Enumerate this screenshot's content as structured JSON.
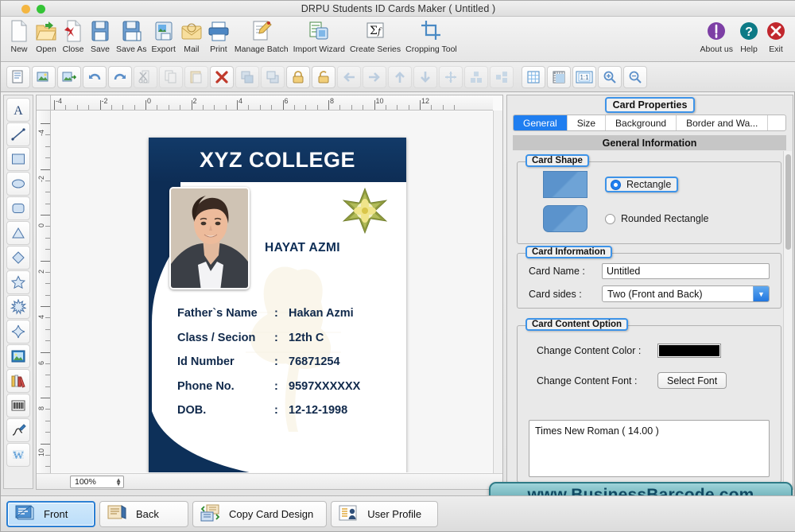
{
  "window": {
    "title": "DRPU Students ID Cards Maker ( Untitled )",
    "dots": [
      "minimize-dot",
      "maximize-dot"
    ]
  },
  "toolbar": {
    "items": [
      {
        "label": "New",
        "icon": "new-document-icon"
      },
      {
        "label": "Open",
        "icon": "open-folder-icon"
      },
      {
        "label": "Close",
        "icon": "close-document-icon"
      },
      {
        "label": "Save",
        "icon": "save-floppy-icon"
      },
      {
        "label": "Save As",
        "icon": "save-as-floppy-icon"
      },
      {
        "label": "Export",
        "icon": "export-image-icon"
      },
      {
        "label": "Mail",
        "icon": "mail-envelope-icon"
      },
      {
        "label": "Print",
        "icon": "printer-icon"
      },
      {
        "label": "Manage Batch",
        "icon": "manage-batch-icon"
      },
      {
        "label": "Import Wizard",
        "icon": "import-wizard-icon"
      },
      {
        "label": "Create Series",
        "icon": "create-series-sigma-icon"
      },
      {
        "label": "Cropping Tool",
        "icon": "cropping-tool-icon"
      }
    ],
    "right_items": [
      {
        "label": "About us",
        "icon": "about-info-icon",
        "color": "#7d3fa5"
      },
      {
        "label": "Help",
        "icon": "help-question-icon",
        "color": "#0d7a86"
      },
      {
        "label": "Exit",
        "icon": "exit-x-icon",
        "color": "#c1272d"
      }
    ]
  },
  "toolbar2": {
    "buttons": [
      {
        "name": "edit-properties-icon",
        "enabled": true
      },
      {
        "name": "insert-image-icon",
        "enabled": true
      },
      {
        "name": "export-image-icon",
        "enabled": true
      },
      {
        "name": "undo-icon",
        "enabled": true
      },
      {
        "name": "redo-icon",
        "enabled": true
      },
      {
        "name": "cut-icon",
        "enabled": false
      },
      {
        "name": "copy-icon",
        "enabled": false
      },
      {
        "name": "paste-icon",
        "enabled": false
      },
      {
        "name": "delete-icon",
        "enabled": true
      },
      {
        "name": "bring-to-front-icon",
        "enabled": false
      },
      {
        "name": "send-to-back-icon",
        "enabled": false
      },
      {
        "name": "lock-icon",
        "enabled": true
      },
      {
        "name": "unlock-icon",
        "enabled": true
      },
      {
        "name": "align-left-icon",
        "enabled": false
      },
      {
        "name": "align-right-icon",
        "enabled": false
      },
      {
        "name": "align-top-icon",
        "enabled": false
      },
      {
        "name": "align-bottom-icon",
        "enabled": false
      },
      {
        "name": "center-icon",
        "enabled": false
      },
      {
        "name": "distribute-horizontal-icon",
        "enabled": false
      },
      {
        "name": "distribute-vertical-icon",
        "enabled": false
      },
      {
        "name": "show-grid-icon",
        "enabled": true
      },
      {
        "name": "show-ruler-icon",
        "enabled": true
      },
      {
        "name": "actual-size-icon",
        "enabled": true,
        "label": "1:1"
      },
      {
        "name": "zoom-in-icon",
        "enabled": true
      },
      {
        "name": "zoom-out-icon",
        "enabled": true
      }
    ]
  },
  "palette": {
    "tools": [
      {
        "name": "text-tool",
        "glyph": "A"
      },
      {
        "name": "line-tool",
        "glyph": "line"
      },
      {
        "name": "rectangle-tool",
        "glyph": "rect"
      },
      {
        "name": "ellipse-tool",
        "glyph": "ellipse"
      },
      {
        "name": "rounded-rectangle-tool",
        "glyph": "roundrect"
      },
      {
        "name": "triangle-tool",
        "glyph": "triangle"
      },
      {
        "name": "diamond-tool",
        "glyph": "diamond"
      },
      {
        "name": "star-tool",
        "glyph": "star5"
      },
      {
        "name": "starburst-tool",
        "glyph": "starburst"
      },
      {
        "name": "four-point-star-tool",
        "glyph": "star4"
      },
      {
        "name": "image-tool",
        "glyph": "image"
      },
      {
        "name": "library-tool",
        "glyph": "books"
      },
      {
        "name": "barcode-tool",
        "glyph": "barcode"
      },
      {
        "name": "signature-tool",
        "glyph": "pen"
      },
      {
        "name": "watermark-tool",
        "glyph": "W"
      }
    ]
  },
  "canvas": {
    "ruler_h_labels": [
      "-4",
      "-2",
      "0",
      "2",
      "4",
      "6",
      "8",
      "10",
      "12"
    ],
    "ruler_v_labels": [
      "-4",
      "-2",
      "0",
      "2",
      "4",
      "6",
      "8",
      "10"
    ],
    "zoom": "100%"
  },
  "card": {
    "college_name": "XYZ COLLEGE",
    "person_name": "HAYAT AZMI",
    "fields": [
      {
        "key": "Father`s Name",
        "colon": ":",
        "value": "Hakan Azmi"
      },
      {
        "key": "Class / Secion",
        "colon": ":",
        "value": "12th C"
      },
      {
        "key": "Id Number",
        "colon": ":",
        "value": "76871254"
      },
      {
        "key": "Phone No.",
        "colon": ":",
        "value": "9597XXXXXX"
      },
      {
        "key": "DOB.",
        "colon": ":",
        "value": "12-12-1998"
      }
    ],
    "colors": {
      "navy": "#0d2d55",
      "header_navy": "#123a68",
      "text_navy": "#10294b"
    }
  },
  "properties": {
    "panel_title": "Card Properties",
    "tabs": [
      {
        "label": "General",
        "active": true
      },
      {
        "label": "Size",
        "active": false
      },
      {
        "label": "Background",
        "active": false
      },
      {
        "label": "Border and Wa...",
        "active": false
      }
    ],
    "section_header": "General Information",
    "card_shape": {
      "group_label": "Card Shape",
      "options": [
        {
          "label": "Rectangle",
          "selected": true,
          "highlighted": true
        },
        {
          "label": "Rounded Rectangle",
          "selected": false,
          "highlighted": false
        }
      ]
    },
    "card_information": {
      "group_label": "Card Information",
      "card_name_label": "Card Name :",
      "card_name_value": "Untitled",
      "card_sides_label": "Card sides :",
      "card_sides_value": "Two (Front and Back)"
    },
    "card_content_option": {
      "group_label": "Card Content Option",
      "content_color_label": "Change Content Color :",
      "content_color_value": "#000000",
      "content_font_label": "Change Content Font :",
      "select_font_button": "Select Font",
      "font_preview": "Times New Roman ( 14.00 )"
    },
    "accent_blue": "#3d93e8",
    "tab_active_blue": "#1f7ef0"
  },
  "watermark": {
    "text": "www.BusinessBarcode.com"
  },
  "bottombar": {
    "buttons": [
      {
        "label": "Front",
        "icon": "card-front-icon",
        "active": true
      },
      {
        "label": "Back",
        "icon": "card-back-icon",
        "active": false
      },
      {
        "label": "Copy Card Design",
        "icon": "copy-design-icon",
        "active": false
      },
      {
        "label": "User Profile",
        "icon": "user-profile-icon",
        "active": false
      }
    ]
  }
}
